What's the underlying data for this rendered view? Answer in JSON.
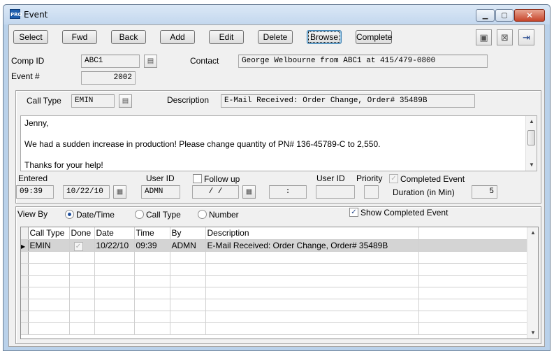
{
  "window": {
    "app_badge": "PRO",
    "title": "Event",
    "minimize_glyph": "▁",
    "maximize_glyph": "▢",
    "close_glyph": "✕"
  },
  "toolbar": {
    "buttons": [
      "Select",
      "Fwd",
      "Back",
      "Add",
      "Edit",
      "Delete",
      "Browse",
      "Complete"
    ],
    "focused": "Browse",
    "icons": [
      "save-icon",
      "cancel-icon",
      "exit-icon"
    ],
    "icon_glyphs": [
      "▣",
      "⊠",
      "⇥"
    ]
  },
  "header": {
    "comp_id_label": "Comp ID",
    "comp_id_value": "ABC1",
    "contact_label": "Contact",
    "contact_value": "George Welbourne from ABC1 at 415/479-0800",
    "event_label": "Event #",
    "event_value": "2002"
  },
  "event": {
    "call_type_label": "Call Type",
    "call_type_value": "EMIN",
    "description_label": "Description",
    "description_value": "E-Mail Received: Order Change, Order# 35489B",
    "notes": [
      "Jenny,",
      "",
      "We had a sudden increase in production! Please change quantity of PN# 136-45789-C to 2,550.",
      "",
      "Thanks for your help!"
    ],
    "entered_label": "Entered",
    "entered_time": "09:39",
    "entered_date": "10/22/10",
    "user_id_label": "User ID",
    "user_id_value": "ADMN",
    "follow_up_label": "Follow up",
    "follow_up_checked": false,
    "follow_up_date": " /  / ",
    "follow_up_time": ":",
    "user_id2_label": "User ID",
    "user_id2_value": "",
    "priority_label": "Priority",
    "priority_value": "",
    "completed_label": "Completed Event",
    "completed_checked": true,
    "duration_label": "Duration (in Min)",
    "duration_value": "5"
  },
  "list": {
    "view_by_label": "View By",
    "view_options": [
      "Date/Time",
      "Call Type",
      "Number"
    ],
    "view_selected": "Date/Time",
    "show_completed_label": "Show Completed Event",
    "show_completed_checked": true,
    "columns": [
      "Call Type",
      "Done",
      "Date",
      "Time",
      "By",
      "Description"
    ],
    "rows": [
      {
        "call_type": "EMIN",
        "done": true,
        "date": "10/22/10",
        "time": "09:39",
        "by": "ADMN",
        "description": "E-Mail Received: Order Change, Order# 35489B"
      }
    ],
    "empty_rows": 7
  },
  "glyphs": {
    "check": "✓",
    "lookup": "▤",
    "calendar": "▦",
    "scroll_up": "▲",
    "scroll_down": "▼",
    "row_pointer": "▶"
  }
}
